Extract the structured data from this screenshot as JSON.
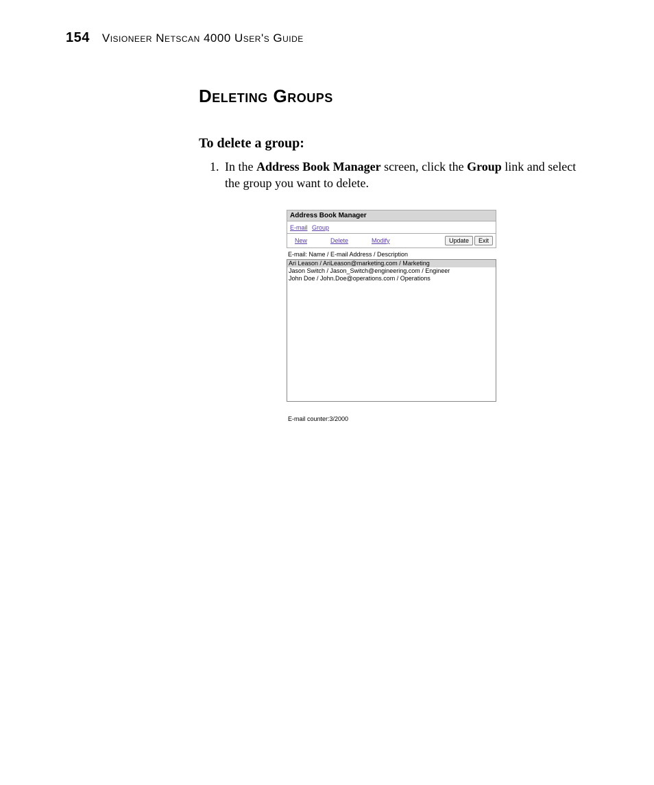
{
  "header": {
    "page_number": "154",
    "running_head": "Visioneer Netscan 4000 User's Guide"
  },
  "section": {
    "title": "Deleting Groups",
    "subhead": "To delete a group:",
    "step1_prefix": "In the ",
    "step1_bold1": "Address Book Manager",
    "step1_mid": " screen, click the ",
    "step1_bold2": "Group",
    "step1_suffix": " link and select the group you want to delete."
  },
  "shot": {
    "title": "Address Book Manager",
    "tab_email": "E-mail",
    "tab_group": "Group",
    "link_new": "New",
    "link_delete": "Delete",
    "link_modify": "Modify",
    "btn_update": "Update",
    "btn_exit": "Exit",
    "col_header": "E-mail: Name / E-mail Address / Description",
    "rows": [
      "Ari Leason / AriLeason@marketing.com / Marketing",
      "Jason Switch / Jason_Switch@engineering.com / Engineer",
      "John Doe / John.Doe@operations.com / Operations"
    ],
    "counter": "E-mail counter:3/2000"
  }
}
